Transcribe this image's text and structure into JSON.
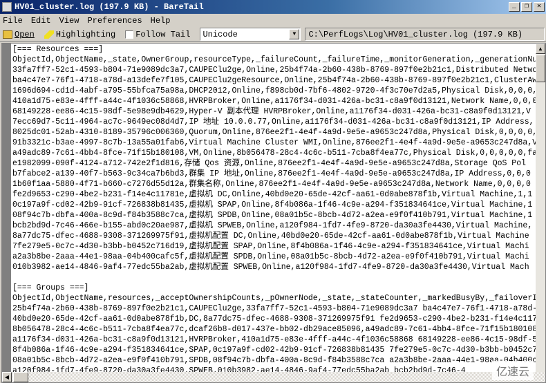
{
  "window": {
    "title": "HV01_cluster.log (197.9 KB) - BareTail"
  },
  "menu": [
    "File",
    "Edit",
    "View",
    "Preferences",
    "Help"
  ],
  "toolbar": {
    "open": "Open",
    "highlighting": "Highlighting",
    "follow_tail": "Follow Tail",
    "follow_tail_checked": false,
    "encoding": "Unicode",
    "path": "C:\\PerfLogs\\Log\\HV01_cluster.log (197.9 KB)"
  },
  "lines": [
    "[=== Resources ===]",
    "ObjectId,ObjectName,_state,OwnerGroup,resourceType,_failureCount,_failureTime,_monitorGeneration,_generationNu",
    "33fa7ff7-52c1-4593-b804-71e9089dc3a7,CAUPEClu2ge,Online,25b4f74a-2b60-438b-8769-897f0e2b21c1,Distributed Netwo",
    "ba4c47e7-76f1-4718-a78d-a13defe7f105,CAUPEClu2geResource,Online,25b4f74a-2b60-438b-8769-897f0e2b21c1,ClusterAw",
    "1696d694-cd1d-4abf-a795-55bfca75a98a,DHCP2012,Online,f898cb0d-7bf6-4802-9720-4f3c70e7d2a5,Physical Disk,0,0,0,",
    "410a1d75-e83e-4fff-a44c-4f1036c58868,HVRPBroker,Online,a1176f34-d031-426a-bc31-c8a9f0d13121,Network Name,0,0,0",
    "68149228-ee86-4c15-98df-5e98e9db4629,Hyper-V 副本代理 HVRPBroker,Online,a1176f34-d031-426a-bc31-c8a9f0d13121,V",
    "7ecc69d7-5c11-4964-ac7c-9649ec08d4d7,IP 地址 10.0.0.77,Online,a1176f34-d031-426a-bc31-c8a9f0d13121,IP Address,",
    "8025dc01-52ab-4310-8189-35796c006360,Quorum,Online,876ee2f1-4e4f-4a9d-9e5e-a9653c247d8a,Physical Disk,0,0,0,0,",
    "91b3321c-b3ae-4997-8c7b-13a55a01fab6,Virtual Machine Cluster WMI,Online,876ee2f1-4e4f-4a9d-9e5e-a9653c247d8a,V",
    "a49adc89-7c61-4bb4-8fce-71f15b180108,VM,Online,8b056478-28c4-4c6c-b511-7cba8f4ea77c,Physical Disk,0,0,0,0,0,fa",
    "e1982099-090f-4124-a712-742e2f1d816,存储 Qos 资源,Online,876ee2f1-4e4f-4a9d-9e5e-a9653c247d8a,Storage QoS Pol",
    "b7fabce2-a139-40f7-b563-9c34ca7b6bd3,群集 IP 地址,Online,876ee2f1-4e4f-4a9d-9e5e-a9653c247d8a,IP Address,0,0,0",
    "1b60f1aa-5880-4f71-b660-c7276d55d12a,群集名称,Online,876ee2f1-4e4f-4a9d-9e5e-a9653c247d8a,Network Name,0,0,0,0",
    "fe2d9653-c290-4be2-b231-f14e4c11781e,虚拟机 DC,Online,40bd0e20-65de-42cf-aa61-0d0abe878f1b,Virtual Machine,1,1",
    "0c197a9f-cd02-42b9-91cf-726838b81435,虚拟机 SPAP,Online,8f4b086a-1f46-4c9e-a294-f351834641ce,Virtual Machine,1",
    "08f94c7b-dbfa-400a-8c9d-f84b3588c7ca,虚拟机 SPDB,Online,08a01b5c-8bcb-4d72-a2ea-e9f0f410b791,Virtual Machine,1",
    "bcb2bd9d-7c46-466e-b155-abd0c20ae987,虚拟机 SPWEB,Online,a120f984-1fd7-4fe9-8720-da30a3fe4430,Virtual Machine,",
    "8a77dc75-dfec-4688-9308-371269975f91,虚拟机配置 DC,Online,40bd0e20-65de-42cf-aa61-0d0abe878f1b,Virtual Machine",
    "7fe279e5-0c7c-4d30-b3bb-b0452c716d19,虚拟机配置 SPAP,Online,8f4b086a-1f46-4c9e-a294-f351834641ce,Virtual Machi",
    "a2a3b8be-2aaa-44e1-98aa-04b400cafc5f,虚拟机配置 SPDB,Online,08a01b5c-8bcb-4d72-a2ea-e9f0f410b791,Virtual Machi",
    "010b3982-ae14-4846-9af4-77edc55ba2ab,虚拟机配置 SPWEB,Online,a120f984-1fd7-4fe9-8720-da30a3fe4430,Virtual Mach",
    "",
    "[=== Groups ===]",
    "ObjectId,ObjectName,resources,_acceptOwnershipCounts,_pOwnerNode,_state,_stateCounter,_markedBusyBy,_failoverI",
    "25b4f74a-2b60-438b-8769-897f0e2b21c1,CAUPEClu2ge,33fa7ff7-52c1-4593-b804-71e9089dc3a7 ba4c47e7-76f1-4718-a78d-",
    "40bd0e20-65de-42cf-aa61-0d0abe878f1b,DC,8a77dc75-dfec-4688-9308-371269975f91 fe2d9653-c290-4be2-b231-f14e4c117",
    "8b056478-28c4-4c6c-b511-7cba8f4ea77c,dcaf26b8-d017-437e-bb02-db29ace85096,a49adc89-7c61-4bb4-8fce-71f15b180108",
    "a1176f34-d031-426a-bc31-c8a9f0d13121,HVRPBroker,410a1d75-e83e-4fff-a44c-4f1036c58868 68149228-ee86-4c15-98df-5",
    "8f4b086a-1f46-4c9e-a294-f351834641ce,SPAP,0c197a9f-cd02-42b9-91cf-726838b81435 7fe279e5-0c7c-4d30-b3bb-b0452c7",
    "08a01b5c-8bcb-4d72-a2ea-e9f0f410b791,SPDB,08f94c7b-dbfa-400a-8c9d-f84b3588c7ca a2a3b8be-2aaa-44e1-98aa-04b400c",
    "a120f984-1fd7-4fe9-8720-da30a3fe4430.SPWEB.010b3982-ae14-4846-9af4-77edc55ba2ab bcb2bd9d-7c46-4"
  ],
  "watermark": "亿速云"
}
